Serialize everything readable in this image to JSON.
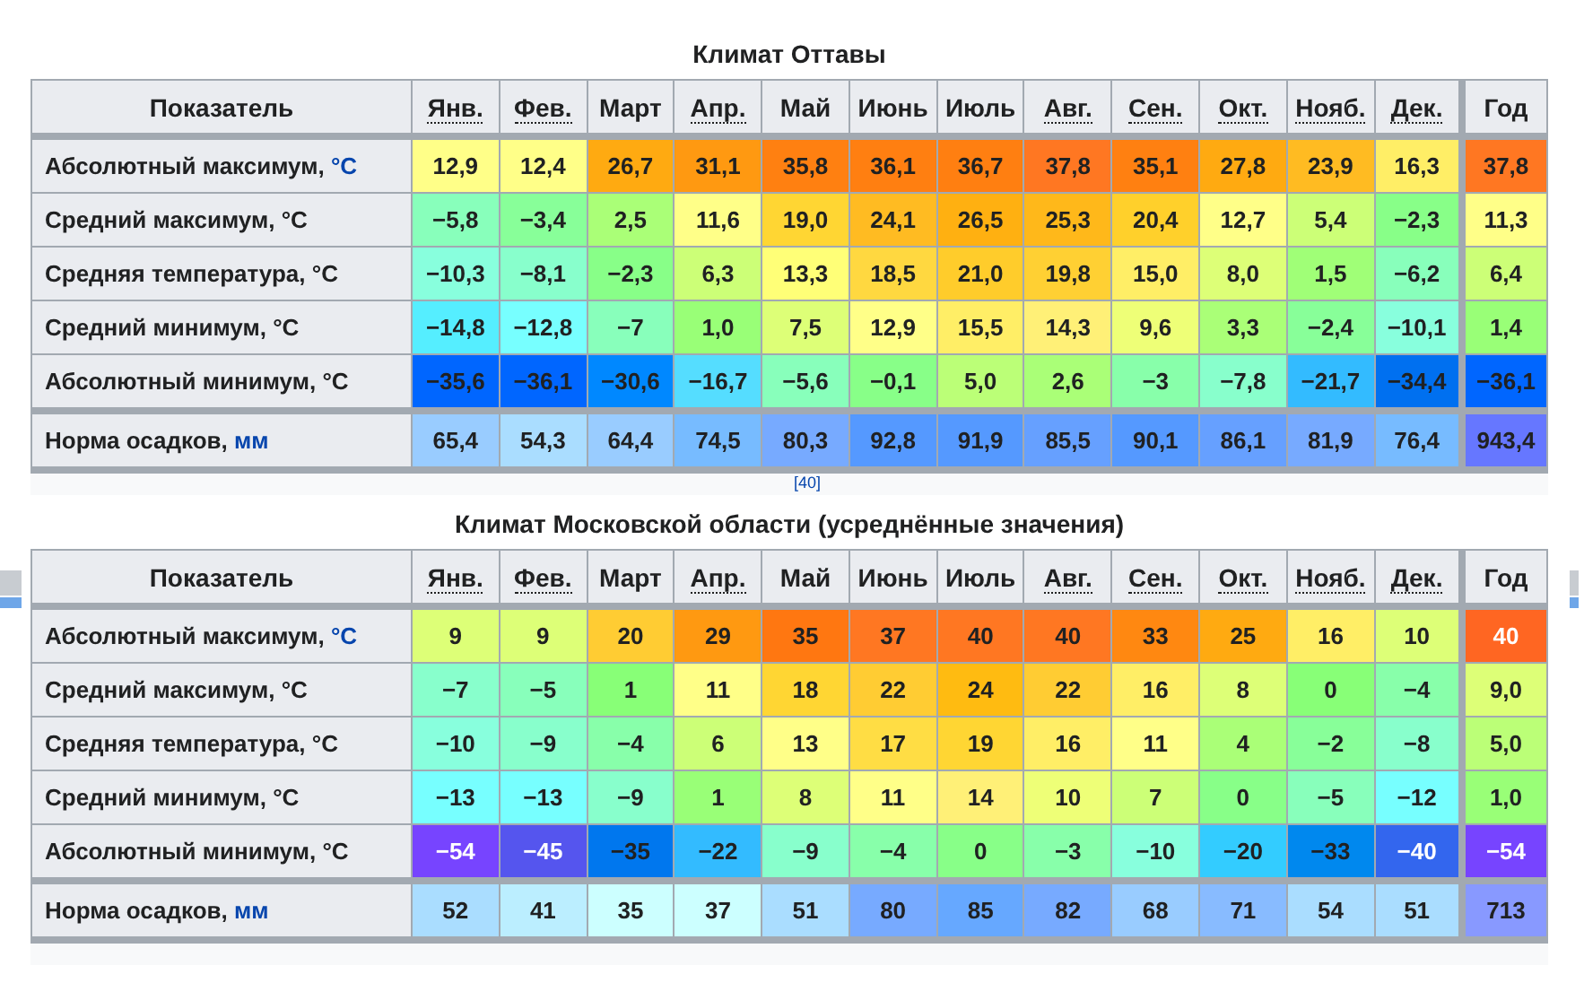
{
  "tables": [
    {
      "title": "Климат Оттавы",
      "row_header": "Показатель",
      "year_label": "Год",
      "reference": "[40]",
      "columns": [
        {
          "label": "Янв.",
          "abbr": true
        },
        {
          "label": "Фев.",
          "abbr": true
        },
        {
          "label": "Март",
          "abbr": false
        },
        {
          "label": "Апр.",
          "abbr": true
        },
        {
          "label": "Май",
          "abbr": false
        },
        {
          "label": "Июнь",
          "abbr": false
        },
        {
          "label": "Июль",
          "abbr": false
        },
        {
          "label": "Авг.",
          "abbr": true
        },
        {
          "label": "Сен.",
          "abbr": true
        },
        {
          "label": "Окт.",
          "abbr": true
        },
        {
          "label": "Нояб.",
          "abbr": true
        },
        {
          "label": "Дек.",
          "abbr": true
        }
      ],
      "rows": [
        {
          "label": "Абсолютный максимум, ",
          "unit": "°C",
          "unit_link": true,
          "separated": false,
          "cells": [
            {
              "value": "12,9",
              "color": "#ffff88"
            },
            {
              "value": "12,4",
              "color": "#ffff88"
            },
            {
              "value": "26,7",
              "color": "#ffaa11"
            },
            {
              "value": "31,1",
              "color": "#ff9911"
            },
            {
              "value": "35,8",
              "color": "#ff8011"
            },
            {
              "value": "36,1",
              "color": "#ff7f11"
            },
            {
              "value": "36,7",
              "color": "#ff7f11"
            },
            {
              "value": "37,8",
              "color": "#ff7722"
            },
            {
              "value": "35,1",
              "color": "#ff8011"
            },
            {
              "value": "27,8",
              "color": "#ffaa11"
            },
            {
              "value": "23,9",
              "color": "#ffbb22"
            },
            {
              "value": "16,3",
              "color": "#ffee66"
            }
          ],
          "year": {
            "value": "37,8",
            "color": "#ff7722"
          }
        },
        {
          "label": "Средний максимум, ",
          "unit": "°C",
          "unit_link": false,
          "separated": false,
          "cells": [
            {
              "value": "−5,8",
              "color": "#88ffbb"
            },
            {
              "value": "−3,4",
              "color": "#88ff99"
            },
            {
              "value": "2,5",
              "color": "#aaff77"
            },
            {
              "value": "11,6",
              "color": "#ffff88"
            },
            {
              "value": "19,0",
              "color": "#ffd633"
            },
            {
              "value": "24,1",
              "color": "#ffbb22"
            },
            {
              "value": "26,5",
              "color": "#ffb011"
            },
            {
              "value": "25,3",
              "color": "#ffb81a"
            },
            {
              "value": "20,4",
              "color": "#ffd02b"
            },
            {
              "value": "12,7",
              "color": "#ffff88"
            },
            {
              "value": "5,4",
              "color": "#ccff77"
            },
            {
              "value": "−2,3",
              "color": "#88ff88"
            }
          ],
          "year": {
            "value": "11,3",
            "color": "#ffff88"
          }
        },
        {
          "label": "Средняя температура, ",
          "unit": "°C",
          "unit_link": false,
          "separated": false,
          "cells": [
            {
              "value": "−10,3",
              "color": "#88ffdd"
            },
            {
              "value": "−8,1",
              "color": "#88ffcc"
            },
            {
              "value": "−2,3",
              "color": "#88ff88"
            },
            {
              "value": "6,3",
              "color": "#ccff77"
            },
            {
              "value": "13,3",
              "color": "#ffff77"
            },
            {
              "value": "18,5",
              "color": "#ffd840"
            },
            {
              "value": "21,0",
              "color": "#ffcc2b"
            },
            {
              "value": "19,8",
              "color": "#ffd033"
            },
            {
              "value": "15,0",
              "color": "#ffee66"
            },
            {
              "value": "8,0",
              "color": "#ddff77"
            },
            {
              "value": "1,5",
              "color": "#a0ff77"
            },
            {
              "value": "−6,2",
              "color": "#88ffbb"
            }
          ],
          "year": {
            "value": "6,4",
            "color": "#ccff77"
          }
        },
        {
          "label": "Средний минимум, ",
          "unit": "°C",
          "unit_link": false,
          "separated": false,
          "cells": [
            {
              "value": "−14,8",
              "color": "#55eeff"
            },
            {
              "value": "−12,8",
              "color": "#77ffff"
            },
            {
              "value": "−7",
              "color": "#88ffbb"
            },
            {
              "value": "1,0",
              "color": "#99ff77"
            },
            {
              "value": "7,5",
              "color": "#ddff77"
            },
            {
              "value": "12,9",
              "color": "#ffff88"
            },
            {
              "value": "15,5",
              "color": "#ffee66"
            },
            {
              "value": "14,3",
              "color": "#fff077"
            },
            {
              "value": "9,6",
              "color": "#eeff77"
            },
            {
              "value": "3,3",
              "color": "#aaff77"
            },
            {
              "value": "−2,4",
              "color": "#88ff99"
            },
            {
              "value": "−10,1",
              "color": "#88ffdd"
            }
          ],
          "year": {
            "value": "1,4",
            "color": "#99ff77"
          }
        },
        {
          "label": "Абсолютный минимум, ",
          "unit": "°C",
          "unit_link": false,
          "separated": false,
          "cells": [
            {
              "value": "−35,6",
              "color": "#0066ff"
            },
            {
              "value": "−36,1",
              "color": "#0066ff"
            },
            {
              "value": "−30,6",
              "color": "#0088ff"
            },
            {
              "value": "−16,7",
              "color": "#55ddff"
            },
            {
              "value": "−5,6",
              "color": "#88ffbb"
            },
            {
              "value": "−0,1",
              "color": "#88ff88"
            },
            {
              "value": "5,0",
              "color": "#bbff77"
            },
            {
              "value": "2,6",
              "color": "#aaff77"
            },
            {
              "value": "−3",
              "color": "#88ffaa"
            },
            {
              "value": "−7,8",
              "color": "#88ffcc"
            },
            {
              "value": "−21,7",
              "color": "#33bbff"
            },
            {
              "value": "−34,4",
              "color": "#0070f0"
            }
          ],
          "year": {
            "value": "−36,1",
            "color": "#0066ff"
          }
        },
        {
          "label": "Норма осадков, ",
          "unit": "мм",
          "unit_link": true,
          "separated": true,
          "cells": [
            {
              "value": "65,4",
              "color": "#99ccff"
            },
            {
              "value": "54,3",
              "color": "#aaddff"
            },
            {
              "value": "64,4",
              "color": "#99ccff"
            },
            {
              "value": "74,5",
              "color": "#77bbff"
            },
            {
              "value": "80,3",
              "color": "#77aaff"
            },
            {
              "value": "92,8",
              "color": "#5599ff"
            },
            {
              "value": "91,9",
              "color": "#5599ff"
            },
            {
              "value": "85,5",
              "color": "#66a0ff"
            },
            {
              "value": "90,1",
              "color": "#5599ff"
            },
            {
              "value": "86,1",
              "color": "#66a0ff"
            },
            {
              "value": "81,9",
              "color": "#77aaff"
            },
            {
              "value": "76,4",
              "color": "#77bbff"
            }
          ],
          "year": {
            "value": "943,4",
            "color": "#6677ff"
          }
        }
      ]
    },
    {
      "title": "Климат Московской области (усреднённые значения)",
      "row_header": "Показатель",
      "year_label": "Год",
      "columns": [
        {
          "label": "Янв.",
          "abbr": true
        },
        {
          "label": "Фев.",
          "abbr": true
        },
        {
          "label": "Март",
          "abbr": false
        },
        {
          "label": "Апр.",
          "abbr": true
        },
        {
          "label": "Май",
          "abbr": false
        },
        {
          "label": "Июнь",
          "abbr": false
        },
        {
          "label": "Июль",
          "abbr": false
        },
        {
          "label": "Авг.",
          "abbr": true
        },
        {
          "label": "Сен.",
          "abbr": true
        },
        {
          "label": "Окт.",
          "abbr": true
        },
        {
          "label": "Нояб.",
          "abbr": true
        },
        {
          "label": "Дек.",
          "abbr": true
        }
      ],
      "rows": [
        {
          "label": "Абсолютный максимум, ",
          "unit": "°C",
          "unit_link": true,
          "separated": false,
          "cells": [
            {
              "value": "9",
              "color": "#ddff77"
            },
            {
              "value": "9",
              "color": "#ddff77"
            },
            {
              "value": "20",
              "color": "#ffcc33"
            },
            {
              "value": "29",
              "color": "#ff9911"
            },
            {
              "value": "35",
              "color": "#ff7711"
            },
            {
              "value": "37",
              "color": "#ff7722"
            },
            {
              "value": "40",
              "color": "#ff7722"
            },
            {
              "value": "40",
              "color": "#ff7722"
            },
            {
              "value": "33",
              "color": "#ff8811"
            },
            {
              "value": "25",
              "color": "#ffaa11"
            },
            {
              "value": "16",
              "color": "#ffee66"
            },
            {
              "value": "10",
              "color": "#ddff77"
            }
          ],
          "year": {
            "value": "40",
            "color": "#ff6622"
          }
        },
        {
          "label": "Средний максимум, ",
          "unit": "°C",
          "unit_link": false,
          "separated": false,
          "cells": [
            {
              "value": "−7",
              "color": "#88ffcc"
            },
            {
              "value": "−5",
              "color": "#88ffbb"
            },
            {
              "value": "1",
              "color": "#88ff77"
            },
            {
              "value": "11",
              "color": "#ffff88"
            },
            {
              "value": "18",
              "color": "#ffd633"
            },
            {
              "value": "22",
              "color": "#ffcc33"
            },
            {
              "value": "24",
              "color": "#ffbb11"
            },
            {
              "value": "22",
              "color": "#ffcc33"
            },
            {
              "value": "16",
              "color": "#ffee66"
            },
            {
              "value": "8",
              "color": "#ddff77"
            },
            {
              "value": "0",
              "color": "#88ff77"
            },
            {
              "value": "−4",
              "color": "#88ffaa"
            }
          ],
          "year": {
            "value": "9,0",
            "color": "#ddff77"
          }
        },
        {
          "label": "Средняя температура, ",
          "unit": "°C",
          "unit_link": false,
          "separated": false,
          "cells": [
            {
              "value": "−10",
              "color": "#88ffdd"
            },
            {
              "value": "−9",
              "color": "#88ffcc"
            },
            {
              "value": "−4",
              "color": "#88ffaa"
            },
            {
              "value": "6",
              "color": "#ccff77"
            },
            {
              "value": "13",
              "color": "#ffff88"
            },
            {
              "value": "17",
              "color": "#ffdd44"
            },
            {
              "value": "19",
              "color": "#ffd633"
            },
            {
              "value": "16",
              "color": "#ffee66"
            },
            {
              "value": "11",
              "color": "#ffff88"
            },
            {
              "value": "4",
              "color": "#aaff77"
            },
            {
              "value": "−2",
              "color": "#88ff99"
            },
            {
              "value": "−8",
              "color": "#88ffcc"
            }
          ],
          "year": {
            "value": "5,0",
            "color": "#bbff77"
          }
        },
        {
          "label": "Средний минимум, ",
          "unit": "°C",
          "unit_link": false,
          "separated": false,
          "cells": [
            {
              "value": "−13",
              "color": "#77ffff"
            },
            {
              "value": "−13",
              "color": "#77ffff"
            },
            {
              "value": "−9",
              "color": "#88ffcc"
            },
            {
              "value": "1",
              "color": "#99ff77"
            },
            {
              "value": "8",
              "color": "#ddff77"
            },
            {
              "value": "11",
              "color": "#ffff88"
            },
            {
              "value": "14",
              "color": "#fff077"
            },
            {
              "value": "10",
              "color": "#eeff77"
            },
            {
              "value": "7",
              "color": "#ccff77"
            },
            {
              "value": "0",
              "color": "#88ff88"
            },
            {
              "value": "−5",
              "color": "#88ffbb"
            },
            {
              "value": "−12",
              "color": "#77ffff"
            }
          ],
          "year": {
            "value": "1,0",
            "color": "#99ff77"
          }
        },
        {
          "label": "Абсолютный минимум, ",
          "unit": "°C",
          "unit_link": false,
          "separated": false,
          "cells": [
            {
              "value": "−54",
              "color": "#7744ff"
            },
            {
              "value": "−45",
              "color": "#5555ee"
            },
            {
              "value": "−35",
              "color": "#0077ee"
            },
            {
              "value": "−22",
              "color": "#33bbff"
            },
            {
              "value": "−9",
              "color": "#88ffcc"
            },
            {
              "value": "−4",
              "color": "#88ffaa"
            },
            {
              "value": "0",
              "color": "#88ff88"
            },
            {
              "value": "−3",
              "color": "#88ffaa"
            },
            {
              "value": "−10",
              "color": "#88ffdd"
            },
            {
              "value": "−20",
              "color": "#33ccff"
            },
            {
              "value": "−33",
              "color": "#0088ee"
            },
            {
              "value": "−40",
              "color": "#3366ee"
            }
          ],
          "year": {
            "value": "−54",
            "color": "#7744ff"
          }
        },
        {
          "label": "Норма осадков, ",
          "unit": "мм",
          "unit_link": true,
          "separated": true,
          "cells": [
            {
              "value": "52",
              "color": "#aaddff"
            },
            {
              "value": "41",
              "color": "#bbeeff"
            },
            {
              "value": "35",
              "color": "#ccffff"
            },
            {
              "value": "37",
              "color": "#ccffff"
            },
            {
              "value": "51",
              "color": "#aaddff"
            },
            {
              "value": "80",
              "color": "#77aaff"
            },
            {
              "value": "85",
              "color": "#66a8ff"
            },
            {
              "value": "82",
              "color": "#77aaff"
            },
            {
              "value": "68",
              "color": "#99ccff"
            },
            {
              "value": "71",
              "color": "#88bbff"
            },
            {
              "value": "54",
              "color": "#aaddff"
            },
            {
              "value": "51",
              "color": "#aaddff"
            }
          ],
          "year": {
            "value": "713",
            "color": "#8899ff"
          }
        }
      ]
    }
  ]
}
